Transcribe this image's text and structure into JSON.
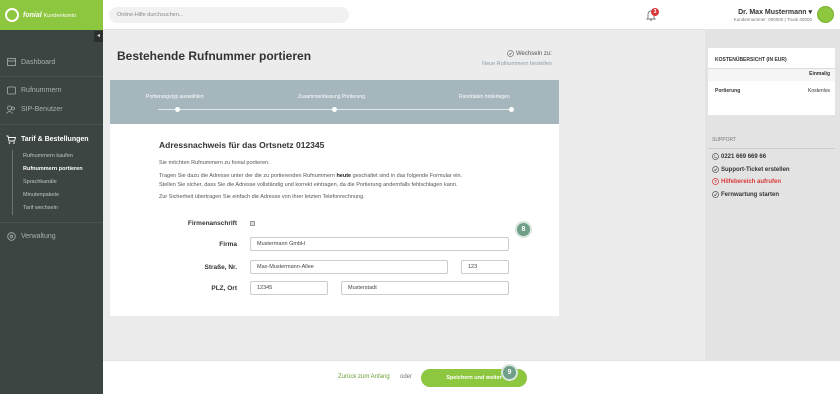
{
  "brand": {
    "logo_main": "fonial",
    "logo_sub": "Kundenkonto",
    "accent": "#8dc63f"
  },
  "sidebar": {
    "collapse_glyph": "◂",
    "items": [
      {
        "label": "Dashboard",
        "icon": "dashboard-icon"
      },
      {
        "label": "Rufnummern",
        "icon": "phone-icon"
      },
      {
        "label": "SIP-Benutzer",
        "icon": "users-icon"
      },
      {
        "label": "Tarif & Bestellungen",
        "icon": "cart-icon"
      },
      {
        "label": "Verwaltung",
        "icon": "cog-icon"
      }
    ],
    "subitems": [
      {
        "label": "Rufnummern kaufen"
      },
      {
        "label": "Rufnummern portieren"
      },
      {
        "label": "Sprachkanäle"
      },
      {
        "label": "Minutenpakete"
      },
      {
        "label": "Tarif wechseln"
      }
    ]
  },
  "topbar": {
    "search_placeholder": "Online-Hilfe durchsuchen...",
    "notification_count": "3",
    "user_name": "Dr. Max Mustermann",
    "user_caret": "▾",
    "user_sub": "Kundennummer: 000000 | Trunk 00000"
  },
  "main": {
    "title": "Bestehende Rufnummer portieren",
    "switch_label": "Wechseln zu:",
    "switch_link": "Neue Rufnummern bestellen",
    "steps": [
      "Portierungstyp auswählen",
      "Zusammenfassung Portierung",
      "Randdaten hinterlegen"
    ],
    "section_title": "Adressnachweis für das Ortsnetz 012345",
    "para1": "Sie möchten Rufnummern zu fonial portieren.",
    "para2_a": "Tragen Sie dazu die Adresse unter der die zu portierenden Rufnummern ",
    "para2_bold": "heute",
    "para2_b": " geschaltet sind in das folgende Formular ein.",
    "para2_c": "Stellen Sie sicher, dass Sie die Adresse vollständig und korrekt eintragen, da die Portierung andernfalls fehlschlagen kann.",
    "para3": "Zur Sicherheit übertragen Sie einfach die Adresse von ihrer letzten Telefonrechnung.",
    "form": {
      "label_company_address": "Firmenanschrift",
      "label_company": "Firma",
      "value_company": "Mustermann GmbH",
      "label_street": "Straße, Nr.",
      "value_street": "Max-Mustermann-Allee",
      "value_number": "123",
      "label_zip_city": "PLZ, Ort",
      "value_zip": "12345",
      "value_city": "Musterstadt"
    },
    "badge_8": "8",
    "badge_9": "9"
  },
  "right_panel": {
    "cost_title": "KOSTENÜBERSICHT (IN EUR)",
    "cost_col": "Einmalig",
    "cost_item": "Portierung",
    "cost_value": "Kostenlos",
    "support_title": "SUPPORT",
    "support_items": [
      {
        "label": "0221 669 669 66",
        "icon": "phone-icon"
      },
      {
        "label": "Support-Ticket erstellen",
        "icon": "check-circle-icon"
      },
      {
        "label": "Hilfebereich aufrufen",
        "icon": "question-circle-icon"
      },
      {
        "label": "Fernwartung starten",
        "icon": "check-circle-icon"
      }
    ]
  },
  "footer": {
    "back_link": "Zurück zum Anfang",
    "or": "oder",
    "save_button": "Speichern und weiter"
  }
}
